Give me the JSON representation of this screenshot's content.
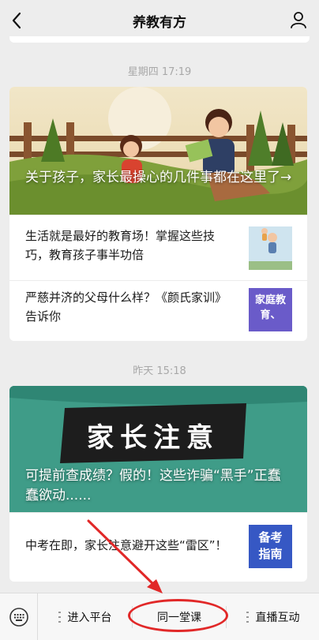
{
  "header": {
    "title": "养教有方"
  },
  "groups": [
    {
      "timestamp": "星期四 17:19",
      "headline": "关于孩子，家长最操心的几件事都在这里了→",
      "items": [
        {
          "text": "生活就是最好的教育场！掌握这些技巧，教育孩子事半功倍"
        },
        {
          "text": "严慈并济的父母什么样？《颜氏家训》告诉你",
          "thumb_text": "家庭教育、"
        }
      ]
    },
    {
      "timestamp": "昨天 15:18",
      "banner_text": "家长注意",
      "headline": "可提前查成绩？假的！这些诈骗“黑手”正蠢蠢欲动......",
      "items": [
        {
          "text": "中考在即，家长注意避开这些“雷区”！",
          "thumb_text": "备考指南"
        }
      ]
    }
  ],
  "menu": {
    "items": [
      {
        "label": "进入平台"
      },
      {
        "label": "同一堂课"
      },
      {
        "label": "直播互动"
      }
    ]
  },
  "colors": {
    "annotation": "#e12828",
    "banner_teal": "#3d9a86",
    "thumb_purple": "#6a5bc9",
    "thumb_blue": "#3658c4"
  }
}
